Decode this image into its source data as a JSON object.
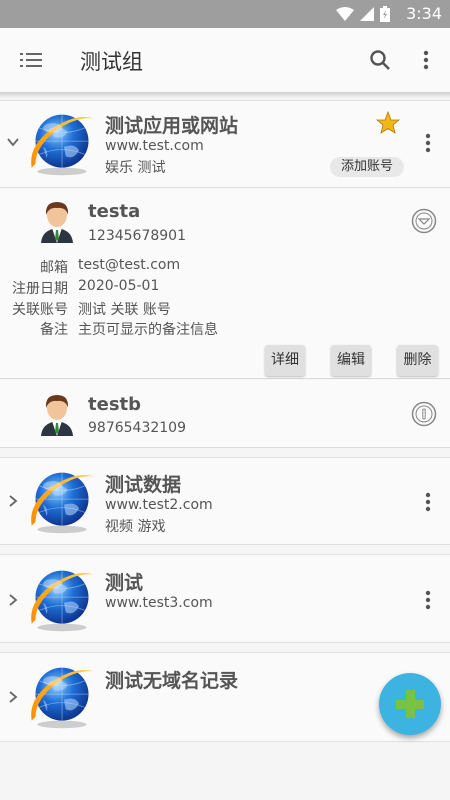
{
  "status_bar": {
    "time": "3:34"
  },
  "toolbar": {
    "title": "测试组"
  },
  "groups": [
    {
      "name": "测试应用或网站",
      "url": "www.test.com",
      "tags": "娱乐 测试",
      "add_account": "添加账号"
    },
    {
      "name": "测试数据",
      "url": "www.test2.com",
      "tags": "视频 游戏"
    },
    {
      "name": "测试",
      "url": "www.test3.com"
    },
    {
      "name": "测试无域名记录"
    }
  ],
  "accounts": [
    {
      "name": "testa",
      "phone": "12345678901",
      "fields": [
        {
          "label": "邮箱",
          "value": "test@test.com"
        },
        {
          "label": "注册日期",
          "value": "2020-05-01"
        },
        {
          "label": "关联账号",
          "value": "测试 关联 账号"
        },
        {
          "label": "备注",
          "value": "主页可显示的备注信息"
        }
      ],
      "actions": {
        "detail": "详细",
        "edit": "编辑",
        "delete": "删除"
      }
    },
    {
      "name": "testb",
      "phone": "98765432109"
    }
  ],
  "icons": {
    "menu": "list-menu-icon",
    "search": "search-icon",
    "more": "more-vert-icon",
    "star": "star-icon",
    "collapse": "collapse-circle-icon",
    "info": "info-circle-icon",
    "fab": "add-plus-icon",
    "globe": "globe-logo-icon",
    "avatar": "user-avatar-icon"
  },
  "colors": {
    "fab": "#3db3e2",
    "plus": "#7cc242",
    "star": "#f2b51c",
    "status_bar": "#9e9e9e"
  }
}
